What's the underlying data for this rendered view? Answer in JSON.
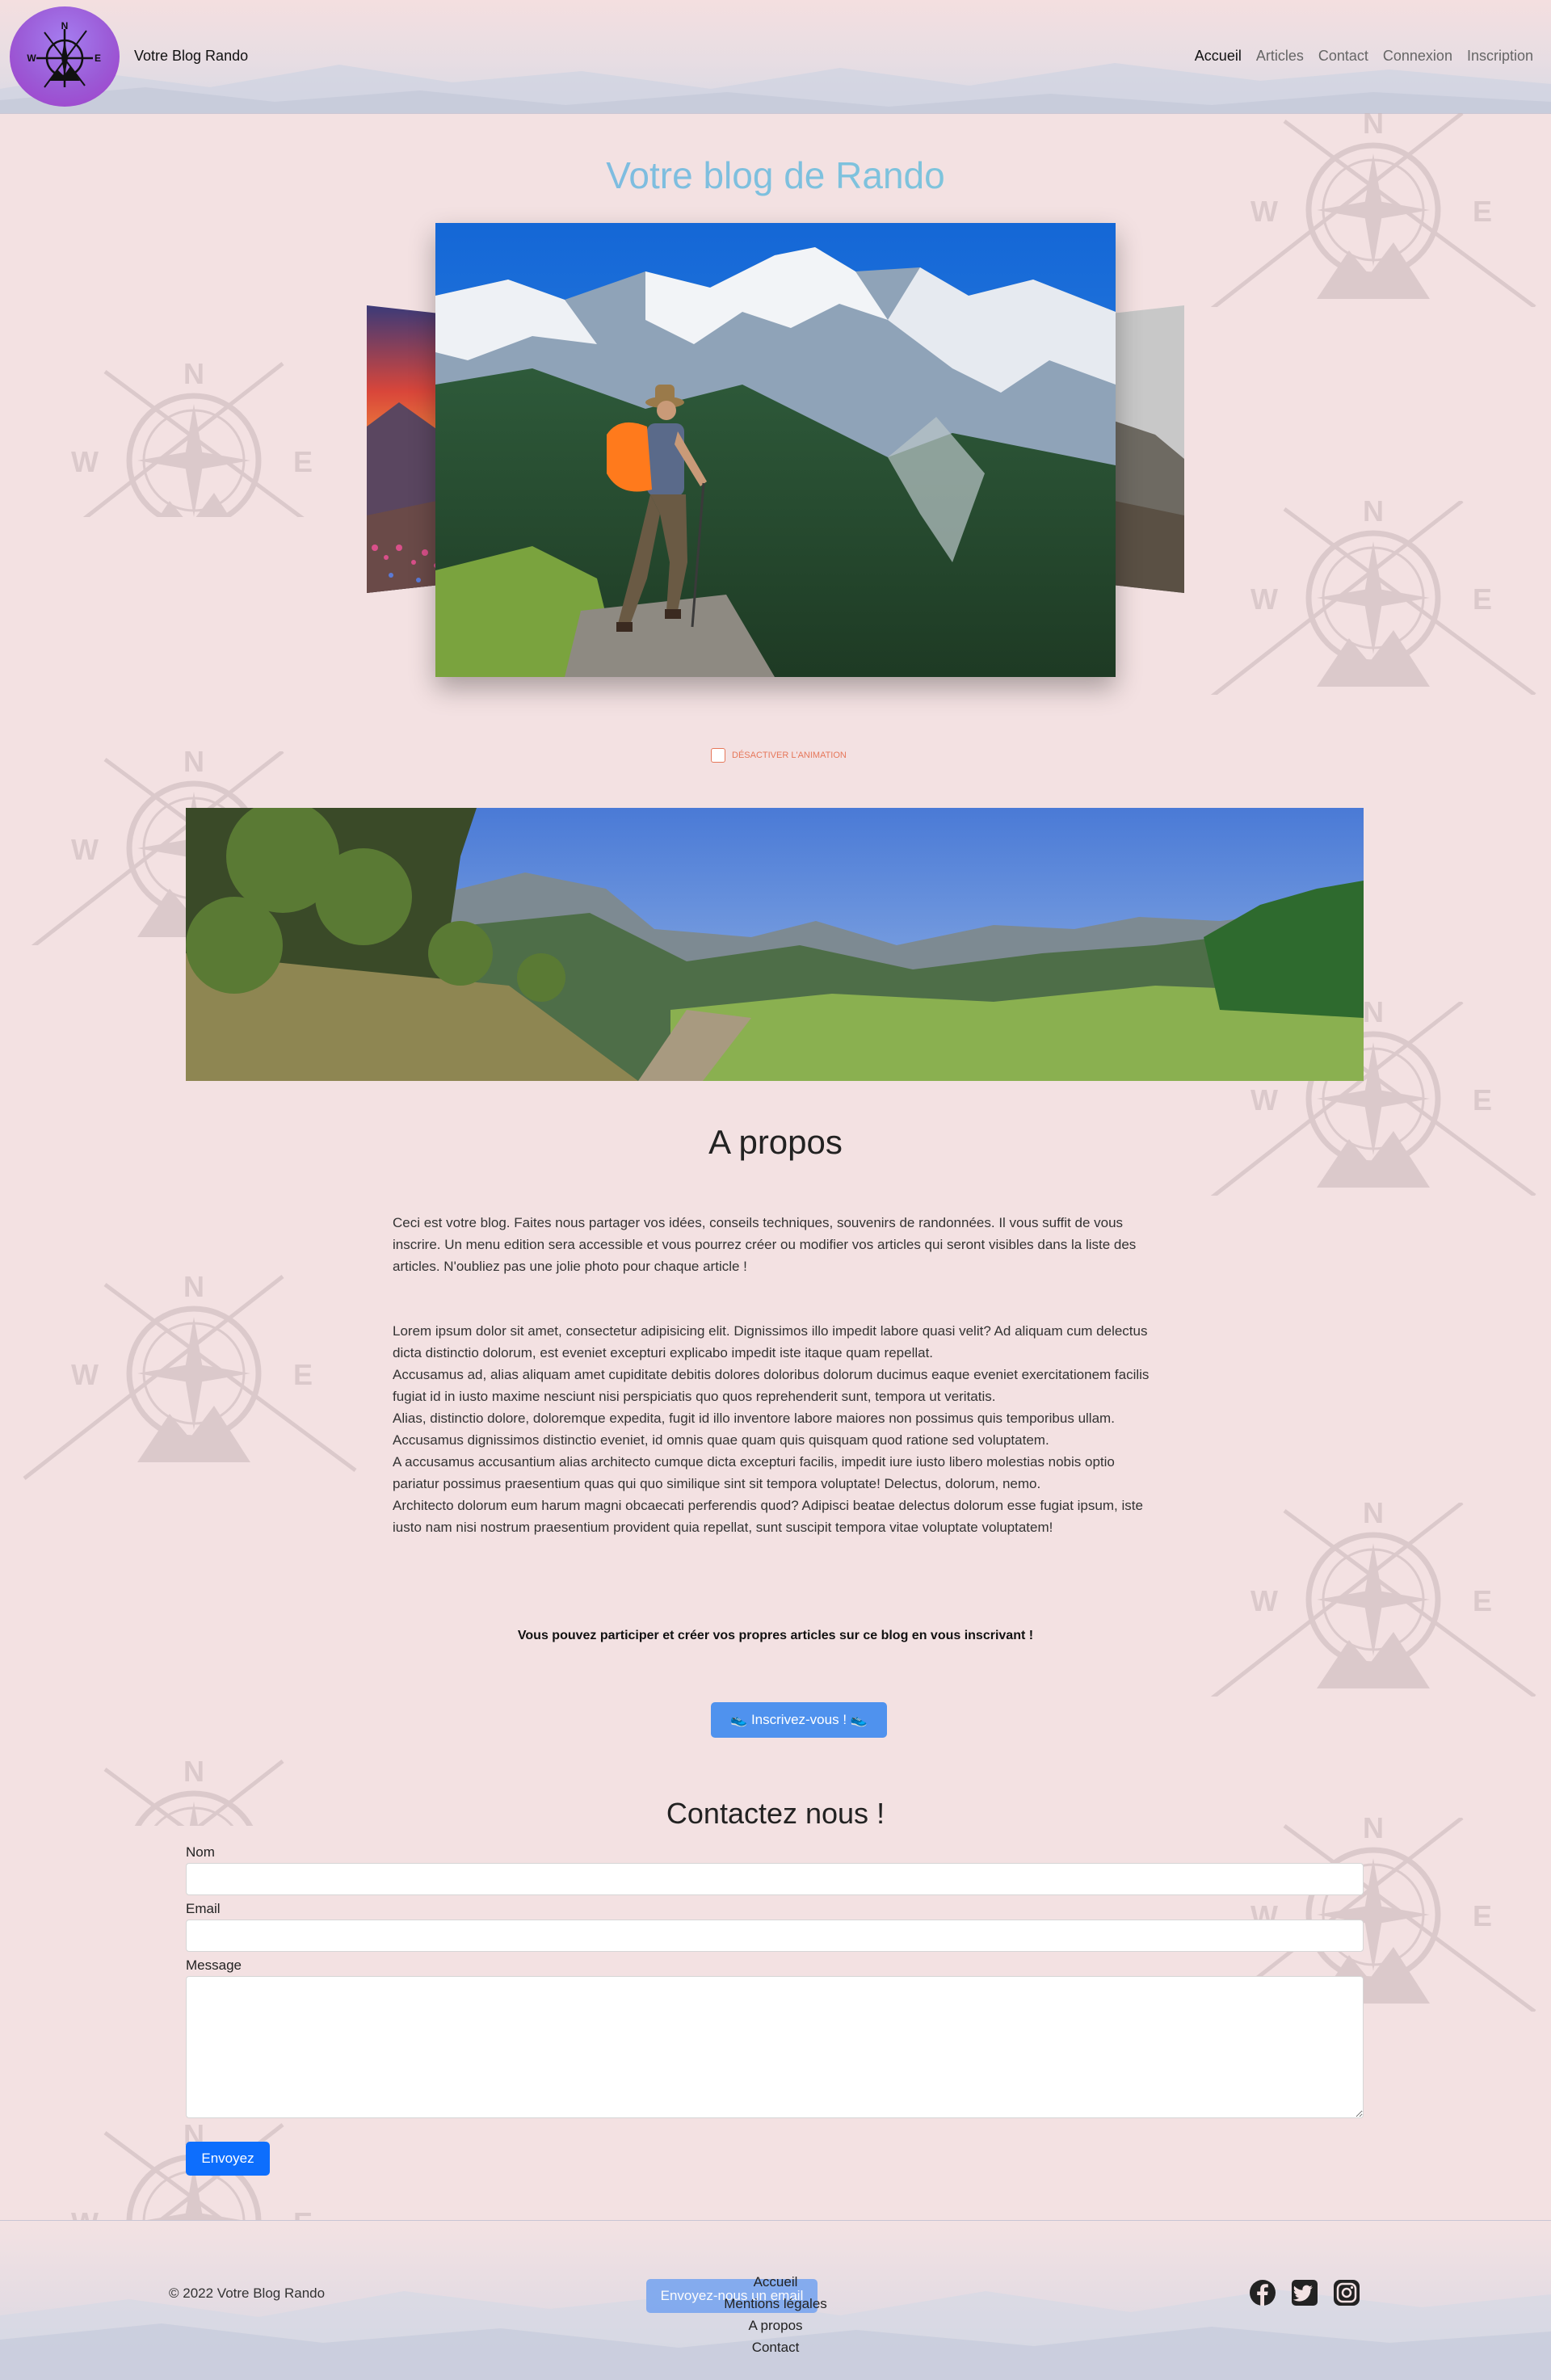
{
  "header": {
    "brand": "Votre Blog Rando",
    "logo_letters": {
      "n": "N",
      "w": "W",
      "e": "E"
    },
    "nav": [
      {
        "label": "Accueil",
        "active": true
      },
      {
        "label": "Articles"
      },
      {
        "label": "Contact"
      },
      {
        "label": "Connexion"
      },
      {
        "label": "Inscription"
      }
    ]
  },
  "hero": {
    "title": "Votre blog de Rando",
    "animation_toggle": "Désactiver l'animation"
  },
  "about": {
    "title": "A propos",
    "intro": "Ceci est votre blog. Faites nous partager vos idées, conseils techniques, souvenirs de randonnées. Il vous suffit de vous inscrire. Un menu edition sera accessible et vous pourrez créer ou modifier vos articles qui seront visibles dans la liste des articles. N'oubliez pas une jolie photo pour chaque article !",
    "lorem_lines": [
      "Lorem ipsum dolor sit amet, consectetur adipisicing elit. Dignissimos illo impedit labore quasi velit? Ad aliquam cum delectus dicta distinctio dolorum, est eveniet excepturi explicabo impedit iste itaque quam repellat.",
      "Accusamus ad, alias aliquam amet cupiditate debitis dolores doloribus dolorum ducimus eaque eveniet exercitationem facilis fugiat id in iusto maxime nesciunt nisi perspiciatis quo quos reprehenderit sunt, tempora ut veritatis.",
      "Alias, distinctio dolore, doloremque expedita, fugit id illo inventore labore maiores non possimus quis temporibus ullam. Accusamus dignissimos distinctio eveniet, id omnis quae quam quis quisquam quod ratione sed voluptatem.",
      "A accusamus accusantium alias architecto cumque dicta excepturi facilis, impedit iure iusto libero molestias nobis optio pariatur possimus praesentium quas qui quo similique sint sit tempora voluptate! Delectus, dolorum, nemo.",
      "Architecto dolorum eum harum magni obcaecati perferendis quod? Adipisci beatae delectus dolorum esse fugiat ipsum, iste iusto nam nisi nostrum praesentium provident quia repellat, sunt suscipit tempora vitae voluptate voluptatem!"
    ],
    "cta": "Vous pouvez participer et créer vos propres articles sur ce blog en vous inscrivant !",
    "signup_button": "Inscrivez-vous !"
  },
  "contact": {
    "title": "Contactez nous !",
    "name_label": "Nom",
    "email_label": "Email",
    "message_label": "Message",
    "submit": "Envoyez"
  },
  "footer": {
    "copyright": "© 2022 Votre Blog Rando",
    "email_button": "Envoyez-nous un email",
    "links": [
      "Accueil",
      "Mentions légales",
      "A propos",
      "Contact"
    ]
  },
  "colors": {
    "page_bg": "#f3e1e2",
    "title_gradient_start": "#7fb0e6",
    "title_gradient_end": "#7dd0d6",
    "primary_button": "#0d6efd",
    "signup_button": "#4f92ee",
    "toggle_accent": "#e6775a"
  },
  "icons": {
    "social": [
      "facebook-icon",
      "twitter-icon",
      "instagram-icon"
    ]
  }
}
